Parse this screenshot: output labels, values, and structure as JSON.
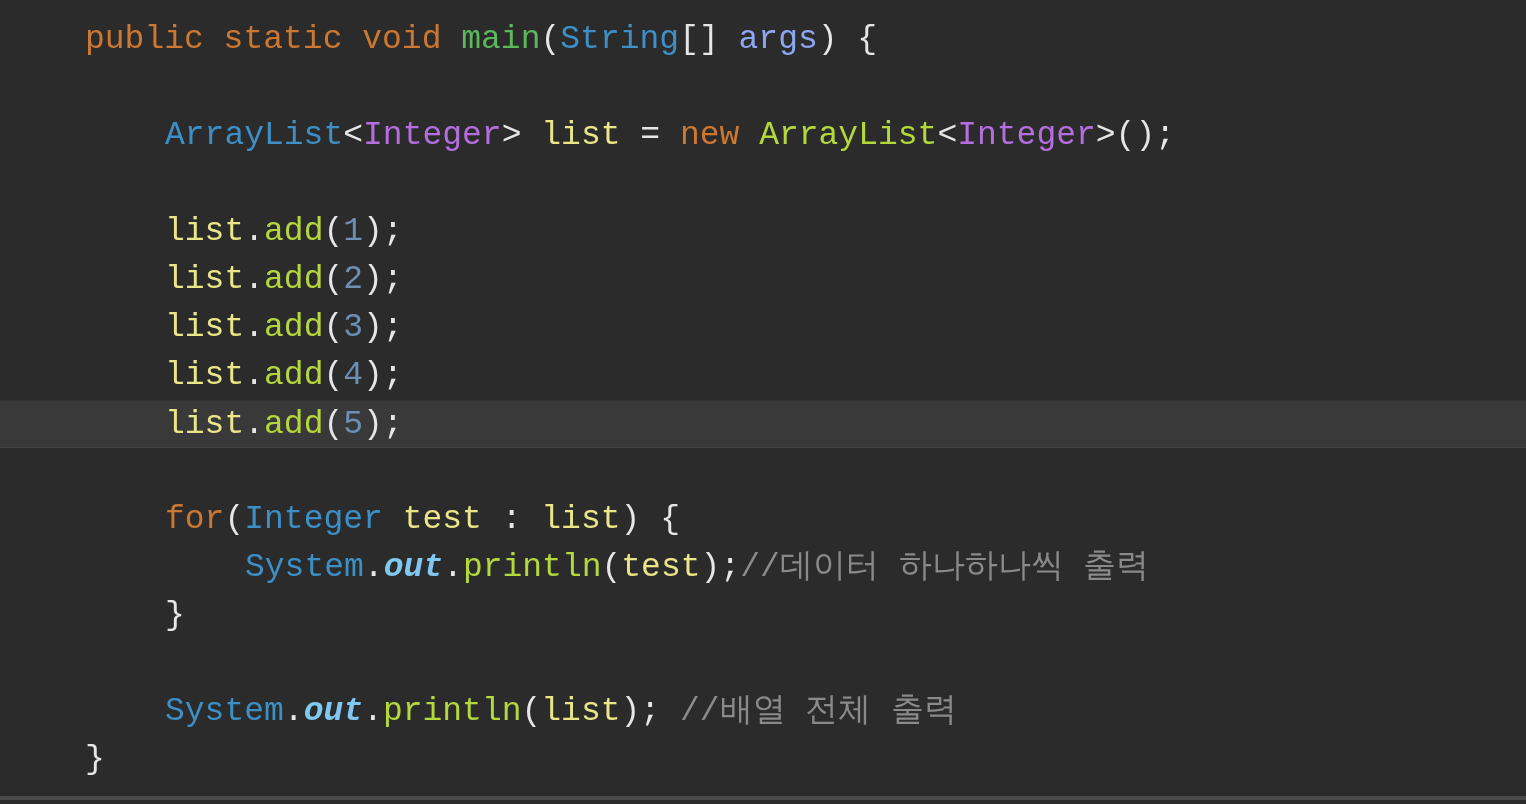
{
  "editor": {
    "lines": [
      {
        "kind": "code",
        "current": false,
        "tokens": [
          {
            "kind": "keyword",
            "text": "public static void "
          },
          {
            "kind": "method",
            "text": "main"
          },
          {
            "kind": "plain",
            "text": "("
          },
          {
            "kind": "type",
            "text": "String"
          },
          {
            "kind": "plain",
            "text": "[] "
          },
          {
            "kind": "param",
            "text": "args"
          },
          {
            "kind": "plain",
            "text": ") {"
          }
        ],
        "children": [
          {
            "kind": "blank",
            "current": false
          },
          {
            "kind": "code",
            "current": false,
            "tokens": [
              {
                "kind": "type",
                "text": "ArrayList"
              },
              {
                "kind": "plain",
                "text": "<"
              },
              {
                "kind": "generic",
                "text": "Integer"
              },
              {
                "kind": "plain",
                "text": "> "
              },
              {
                "kind": "variable",
                "text": "list"
              },
              {
                "kind": "plain",
                "text": " = "
              },
              {
                "kind": "keyword",
                "text": "new "
              },
              {
                "kind": "call",
                "text": "ArrayList"
              },
              {
                "kind": "plain",
                "text": "<"
              },
              {
                "kind": "generic",
                "text": "Integer"
              },
              {
                "kind": "plain",
                "text": ">();"
              }
            ]
          },
          {
            "kind": "blank",
            "current": false
          },
          {
            "kind": "code",
            "current": false,
            "tokens": [
              {
                "kind": "variable",
                "text": "list"
              },
              {
                "kind": "plain",
                "text": "."
              },
              {
                "kind": "call",
                "text": "add"
              },
              {
                "kind": "plain",
                "text": "("
              },
              {
                "kind": "number",
                "text": "1"
              },
              {
                "kind": "plain",
                "text": ");"
              }
            ]
          },
          {
            "kind": "code",
            "current": false,
            "tokens": [
              {
                "kind": "variable",
                "text": "list"
              },
              {
                "kind": "plain",
                "text": "."
              },
              {
                "kind": "call",
                "text": "add"
              },
              {
                "kind": "plain",
                "text": "("
              },
              {
                "kind": "number",
                "text": "2"
              },
              {
                "kind": "plain",
                "text": ");"
              }
            ]
          },
          {
            "kind": "code",
            "current": false,
            "tokens": [
              {
                "kind": "variable",
                "text": "list"
              },
              {
                "kind": "plain",
                "text": "."
              },
              {
                "kind": "call",
                "text": "add"
              },
              {
                "kind": "plain",
                "text": "("
              },
              {
                "kind": "number",
                "text": "3"
              },
              {
                "kind": "plain",
                "text": ");"
              }
            ]
          },
          {
            "kind": "code",
            "current": false,
            "tokens": [
              {
                "kind": "variable",
                "text": "list"
              },
              {
                "kind": "plain",
                "text": "."
              },
              {
                "kind": "call",
                "text": "add"
              },
              {
                "kind": "plain",
                "text": "("
              },
              {
                "kind": "number",
                "text": "4"
              },
              {
                "kind": "plain",
                "text": ");"
              }
            ]
          },
          {
            "kind": "code",
            "current": true,
            "tokens": [
              {
                "kind": "variable",
                "text": "list"
              },
              {
                "kind": "plain",
                "text": "."
              },
              {
                "kind": "call",
                "text": "add"
              },
              {
                "kind": "plain",
                "text": "("
              },
              {
                "kind": "number",
                "text": "5"
              },
              {
                "kind": "plain",
                "text": ");"
              }
            ]
          },
          {
            "kind": "blank",
            "current": false
          },
          {
            "kind": "code",
            "current": false,
            "tokens": [
              {
                "kind": "keyword",
                "text": "for"
              },
              {
                "kind": "plain",
                "text": "("
              },
              {
                "kind": "type",
                "text": "Integer "
              },
              {
                "kind": "variable",
                "text": "test"
              },
              {
                "kind": "plain",
                "text": " : "
              },
              {
                "kind": "variable",
                "text": "list"
              },
              {
                "kind": "plain",
                "text": ") {"
              }
            ],
            "children": [
              {
                "kind": "code",
                "current": false,
                "tokens": [
                  {
                    "kind": "type",
                    "text": "System"
                  },
                  {
                    "kind": "plain",
                    "text": "."
                  },
                  {
                    "kind": "field",
                    "text": "out"
                  },
                  {
                    "kind": "plain",
                    "text": "."
                  },
                  {
                    "kind": "call",
                    "text": "println"
                  },
                  {
                    "kind": "plain",
                    "text": "("
                  },
                  {
                    "kind": "variable",
                    "text": "test"
                  },
                  {
                    "kind": "plain",
                    "text": ");"
                  },
                  {
                    "kind": "comment",
                    "text": "//데이터 하나하나씩 출력"
                  }
                ]
              }
            ]
          },
          {
            "kind": "code",
            "current": false,
            "tokens": [
              {
                "kind": "plain",
                "text": "}"
              }
            ]
          },
          {
            "kind": "blank",
            "current": false
          },
          {
            "kind": "code",
            "current": false,
            "tokens": [
              {
                "kind": "type",
                "text": "System"
              },
              {
                "kind": "plain",
                "text": "."
              },
              {
                "kind": "field",
                "text": "out"
              },
              {
                "kind": "plain",
                "text": "."
              },
              {
                "kind": "call",
                "text": "println"
              },
              {
                "kind": "plain",
                "text": "("
              },
              {
                "kind": "variable",
                "text": "list"
              },
              {
                "kind": "plain",
                "text": "); "
              },
              {
                "kind": "comment",
                "text": "//배열 전체 출력"
              }
            ]
          }
        ]
      },
      {
        "kind": "code",
        "current": false,
        "tokens": [
          {
            "kind": "plain",
            "text": "}"
          }
        ]
      }
    ]
  }
}
